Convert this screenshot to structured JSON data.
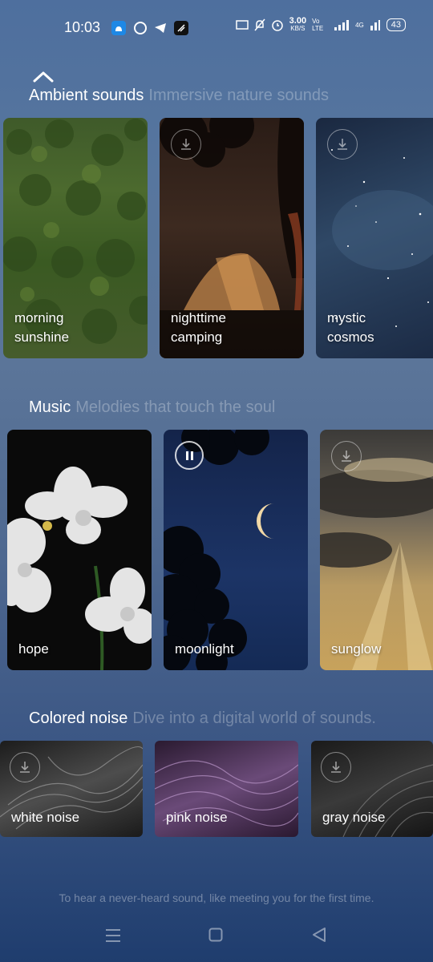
{
  "status": {
    "time": "10:03",
    "speed_top": "3.00",
    "speed_unit": "KB/S",
    "volte": "Vo LTE",
    "net": "4G",
    "battery": "43"
  },
  "ambient": {
    "title": "Ambient sounds",
    "subtitle": "Immersive nature sounds",
    "cards": [
      {
        "line1": "morning",
        "line2": "sunshine"
      },
      {
        "line1": "nighttime",
        "line2": "camping"
      },
      {
        "line1": "mystic",
        "line2": "cosmos"
      }
    ]
  },
  "music": {
    "title": "Music",
    "subtitle": "Melodies that touch the soul",
    "cards": [
      {
        "label": "hope"
      },
      {
        "label": "moonlight"
      },
      {
        "label": "sunglow"
      }
    ]
  },
  "noise": {
    "title": "Colored noise",
    "subtitle": "Dive into a digital world of sounds.",
    "cards": [
      {
        "label": "white noise"
      },
      {
        "label": "pink noise"
      },
      {
        "label": "gray noise"
      }
    ]
  },
  "footer": "To hear a never-heard sound, like meeting you for the first time."
}
